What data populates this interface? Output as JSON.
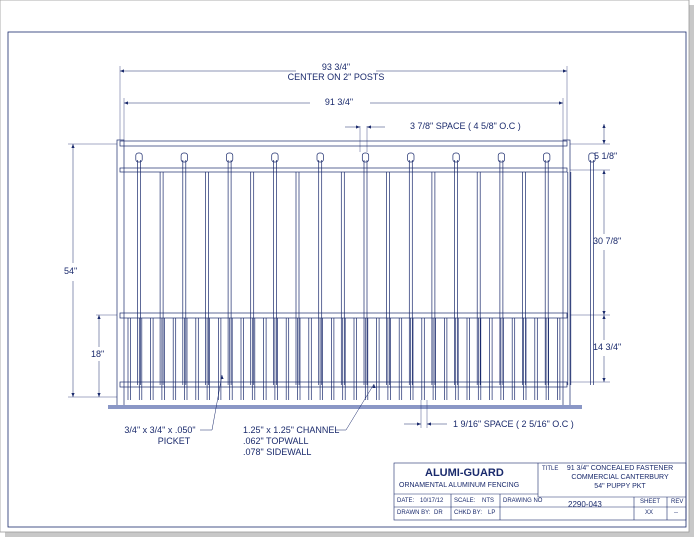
{
  "colors": {
    "ink": "#1a2a6c",
    "ground": "#8a97c6"
  },
  "dimensions": {
    "overall_width": "93 3/4\"",
    "overall_width_note": "CENTER ON 2\" POSTS",
    "panel_width": "91 3/4\"",
    "top_spacing": "3 7/8\" SPACE ( 4 5/8\" O.C )",
    "top_section": "5 1/8\"",
    "middle_section": "30 7/8\"",
    "bottom_section": "14 3/4\"",
    "overall_height": "54\"",
    "puppy_height": "18\"",
    "bottom_spacing": "1 9/16\" SPACE ( 2 5/16\" O.C )"
  },
  "callouts": {
    "picket_size": "3/4\" x 3/4\" x .050\"",
    "picket_label": "PICKET",
    "channel": "1.25\" x 1.25\" CHANNEL",
    "topwall": ".062\" TOPWALL",
    "sidewall": ".078\" SIDEWALL"
  },
  "title_block": {
    "company": "ALUMI-GUARD",
    "subtitle": "ORNAMENTAL ALUMINUM FENCING",
    "title_label": "TITLE",
    "title_line1": "91 3/4\" CONCEALED FASTENER",
    "title_line2": "COMMERCIAL CANTERBURY",
    "title_line3": "54\" PUPPY PKT",
    "date_label": "DATE:",
    "date_value": "10/17/12",
    "scale_label": "SCALE:",
    "scale_value": "NTS",
    "drawing_no_label": "DRAWING NO",
    "drawing_no_value": "2290-043",
    "sheet_label": "SHEET",
    "sheet_value": "XX",
    "rev_label": "REV",
    "rev_value": "--",
    "drawn_by_label": "DRAWN BY:",
    "drawn_by_value": "DR",
    "chkd_by_label": "CHKD BY:",
    "chkd_by_value": "LP"
  }
}
